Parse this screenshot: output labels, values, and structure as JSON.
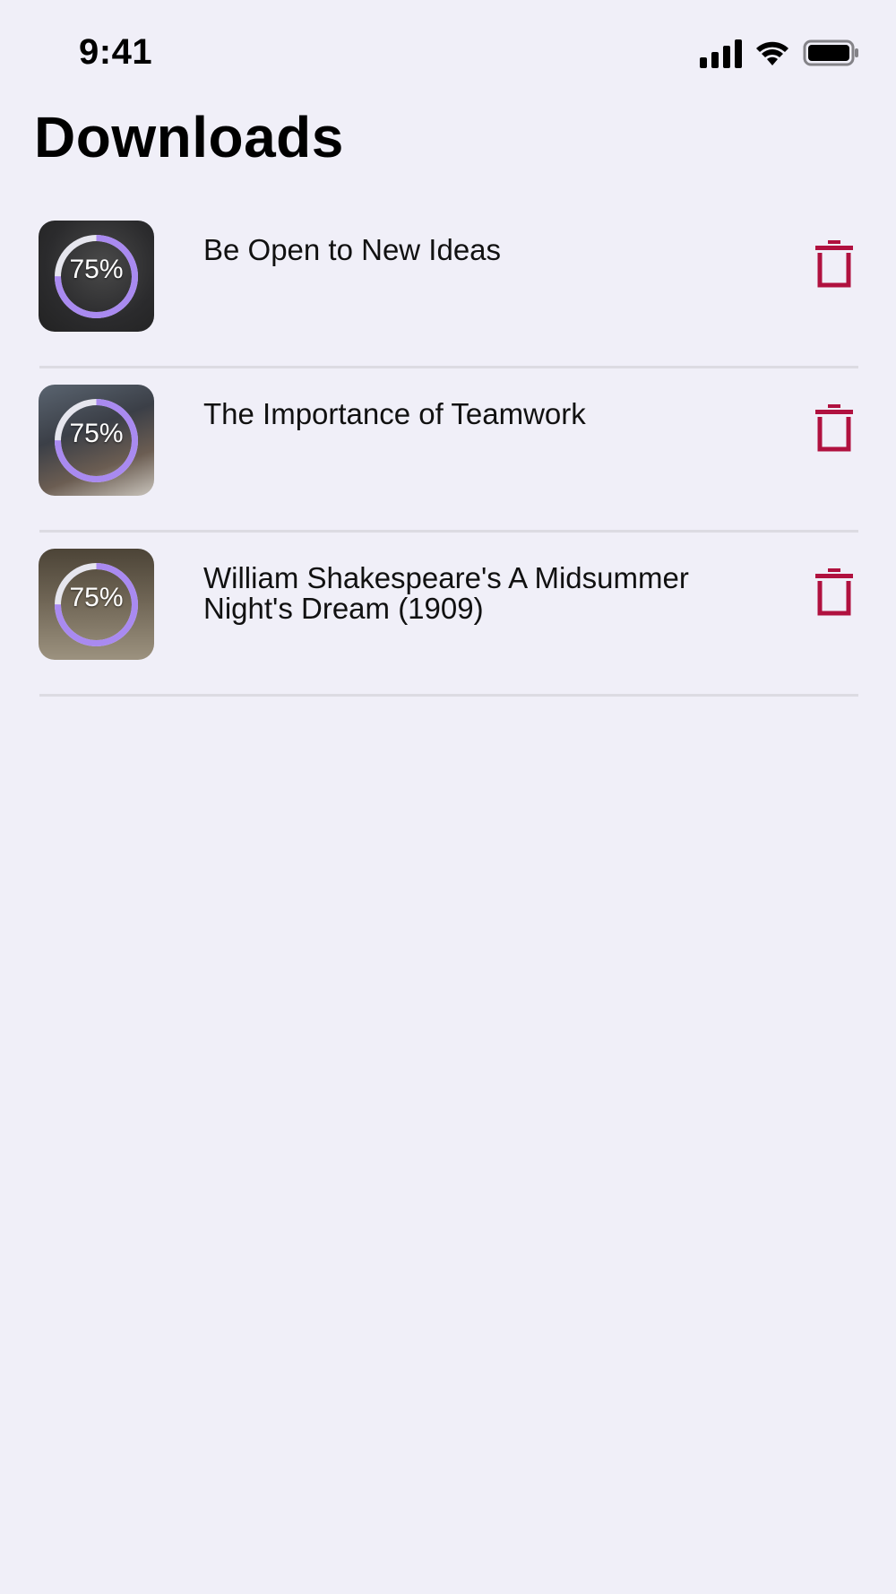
{
  "status_bar": {
    "time": "9:41"
  },
  "page": {
    "title": "Downloads"
  },
  "colors": {
    "background": "#f0eff8",
    "progress_ring": "#a98af0",
    "delete_icon": "#b0113f",
    "divider": "#dcdbe2"
  },
  "downloads": [
    {
      "title": "Be Open to New Ideas",
      "progress_label": "75%",
      "progress": 0.75,
      "delete_icon": "trash-icon"
    },
    {
      "title": "The Importance of Teamwork",
      "progress_label": "75%",
      "progress": 0.75,
      "delete_icon": "trash-icon"
    },
    {
      "title": "William Shakespeare's A Midsummer Night's Dream (1909)",
      "progress_label": "75%",
      "progress": 0.75,
      "delete_icon": "trash-icon"
    }
  ]
}
